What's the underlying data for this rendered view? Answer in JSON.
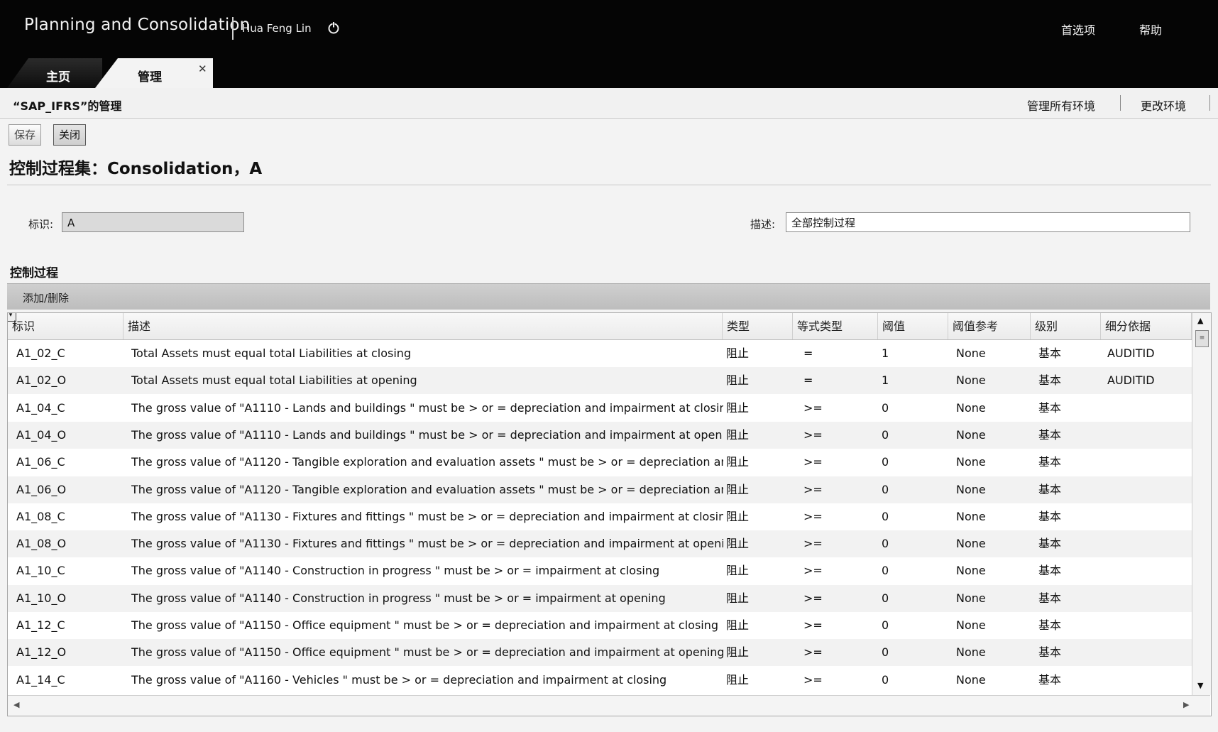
{
  "app": {
    "title": "Planning and Consolidation",
    "user": "Hua Feng Lin",
    "links": {
      "preferences": "首选项",
      "help": "帮助"
    }
  },
  "tabs": [
    {
      "label": "主页"
    },
    {
      "label": "管理"
    }
  ],
  "subheader": {
    "title": "“SAP_IFRS”的管理",
    "manage_envs": "管理所有环境",
    "change_env": "更改环境"
  },
  "toolbar": {
    "save_label": "保存",
    "close_label": "关闭"
  },
  "heading": "控制过程集：Consolidation，A",
  "form": {
    "id_label": "标识:",
    "id_value": "A",
    "desc_label": "描述:",
    "desc_value": "全部控制过程"
  },
  "section_title": "控制过程",
  "table_toolbar": {
    "add_remove": "添加/删除"
  },
  "table": {
    "columns": [
      "标识",
      "描述",
      "类型",
      "等式类型",
      "阈值",
      "阈值参考",
      "级别",
      "细分依据"
    ],
    "rows": [
      [
        "A1_02_C",
        "Total Assets must equal total Liabilities at closing",
        "阻止",
        "=",
        "1",
        "None",
        "基本",
        "AUDITID"
      ],
      [
        "A1_02_O",
        "Total Assets must equal total Liabilities at opening",
        "阻止",
        "=",
        "1",
        "None",
        "基本",
        "AUDITID"
      ],
      [
        "A1_04_C",
        "The gross value of \"A1110 - Lands and buildings \" must be > or = depreciation and impairment at closing",
        "阻止",
        ">=",
        "0",
        "None",
        "基本",
        ""
      ],
      [
        "A1_04_O",
        "The gross value of \"A1110 - Lands and buildings \" must be > or = depreciation and impairment at opening",
        "阻止",
        ">=",
        "0",
        "None",
        "基本",
        ""
      ],
      [
        "A1_06_C",
        "The gross value of \"A1120 - Tangible exploration and evaluation assets \" must be > or = depreciation and in",
        "阻止",
        ">=",
        "0",
        "None",
        "基本",
        ""
      ],
      [
        "A1_06_O",
        "The gross value of \"A1120 - Tangible exploration and evaluation assets \" must be > or = depreciation and in",
        "阻止",
        ">=",
        "0",
        "None",
        "基本",
        ""
      ],
      [
        "A1_08_C",
        "The gross value of \"A1130 - Fixtures and fittings \" must be > or = depreciation and impairment at closing",
        "阻止",
        ">=",
        "0",
        "None",
        "基本",
        ""
      ],
      [
        "A1_08_O",
        "The gross value of \"A1130 - Fixtures and fittings \" must be > or = depreciation and impairment at opening",
        "阻止",
        ">=",
        "0",
        "None",
        "基本",
        ""
      ],
      [
        "A1_10_C",
        "The gross value of \"A1140 - Construction in progress \" must be > or = impairment at closing",
        "阻止",
        ">=",
        "0",
        "None",
        "基本",
        ""
      ],
      [
        "A1_10_O",
        "The gross value of \"A1140 - Construction in progress \" must be > or = impairment at opening",
        "阻止",
        ">=",
        "0",
        "None",
        "基本",
        ""
      ],
      [
        "A1_12_C",
        "The gross value of \"A1150 - Office equipment \" must be > or = depreciation and impairment at closing",
        "阻止",
        ">=",
        "0",
        "None",
        "基本",
        ""
      ],
      [
        "A1_12_O",
        "The gross value of \"A1150 - Office equipment \" must be > or = depreciation and impairment at opening",
        "阻止",
        ">=",
        "0",
        "None",
        "基本",
        ""
      ],
      [
        "A1_14_C",
        "The gross value of \"A1160 - Vehicles \" must be > or = depreciation and impairment at closing",
        "阻止",
        ">=",
        "0",
        "None",
        "基本",
        ""
      ]
    ]
  }
}
